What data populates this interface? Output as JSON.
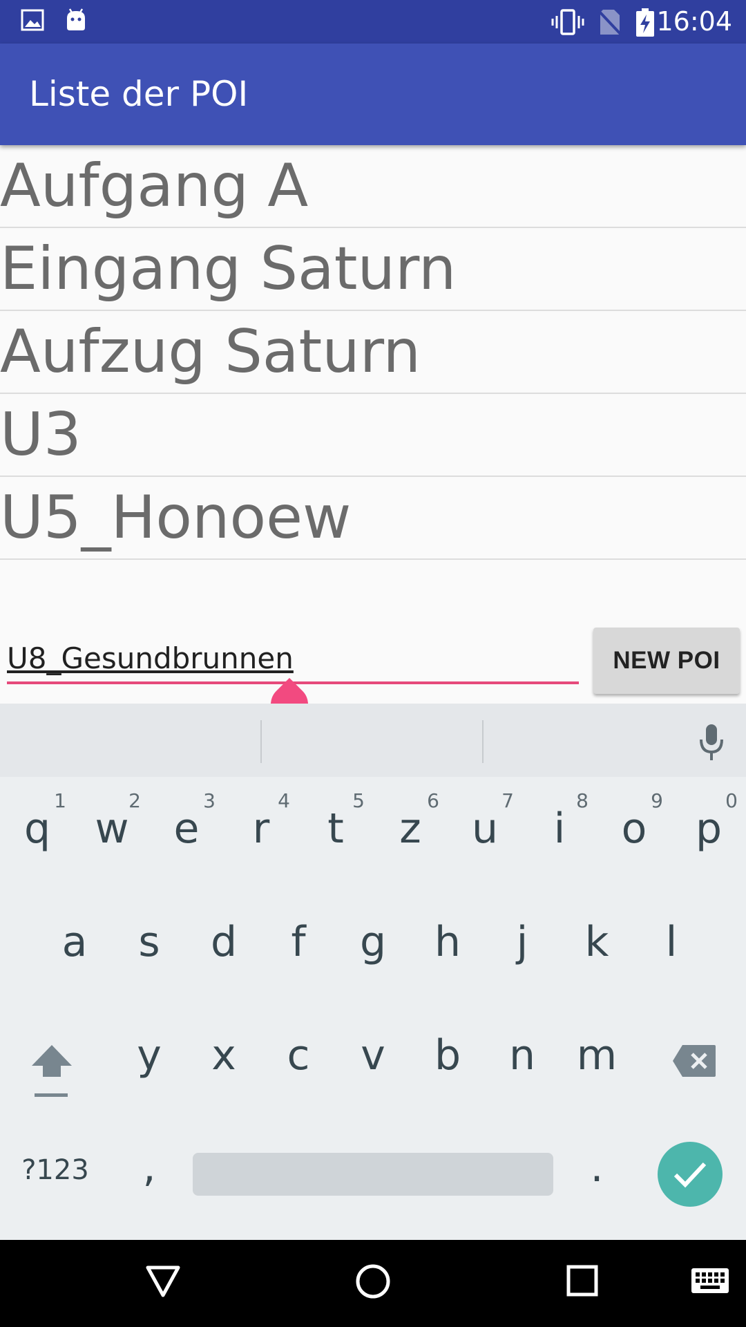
{
  "status_bar": {
    "time": "16:04",
    "icons": [
      "gallery-icon",
      "android-icon",
      "vibrate-icon",
      "no-sim-icon",
      "battery-charging-icon"
    ]
  },
  "app_bar": {
    "title": "Liste der POI"
  },
  "poi_list": [
    "Aufgang A",
    "Eingang Saturn",
    "Aufzug Saturn",
    "U3",
    "U5_Honoew"
  ],
  "input": {
    "value": "U8_Gesundbrunnen"
  },
  "new_poi_button": {
    "label": "NEW POI"
  },
  "keyboard": {
    "row1": [
      {
        "key": "q",
        "hint": "1"
      },
      {
        "key": "w",
        "hint": "2"
      },
      {
        "key": "e",
        "hint": "3"
      },
      {
        "key": "r",
        "hint": "4"
      },
      {
        "key": "t",
        "hint": "5"
      },
      {
        "key": "z",
        "hint": "6"
      },
      {
        "key": "u",
        "hint": "7"
      },
      {
        "key": "i",
        "hint": "8"
      },
      {
        "key": "o",
        "hint": "9"
      },
      {
        "key": "p",
        "hint": "0"
      }
    ],
    "row2": [
      "a",
      "s",
      "d",
      "f",
      "g",
      "h",
      "j",
      "k",
      "l"
    ],
    "row3": [
      "y",
      "x",
      "c",
      "v",
      "b",
      "n",
      "m"
    ],
    "symbols_label": "?123",
    "comma": ",",
    "period": ".",
    "icons": [
      "shift-icon",
      "backspace-icon",
      "mic-icon",
      "enter-check-icon"
    ]
  },
  "nav_bar": {
    "icons": [
      "back-icon",
      "home-icon",
      "recents-icon",
      "keyboard-switch-icon"
    ]
  },
  "colors": {
    "status_bar": "#303f9f",
    "app_bar": "#3f51b5",
    "accent": "#e64a7b",
    "enter_key": "#4db6ac",
    "keyboard_bg": "#eceff1"
  }
}
